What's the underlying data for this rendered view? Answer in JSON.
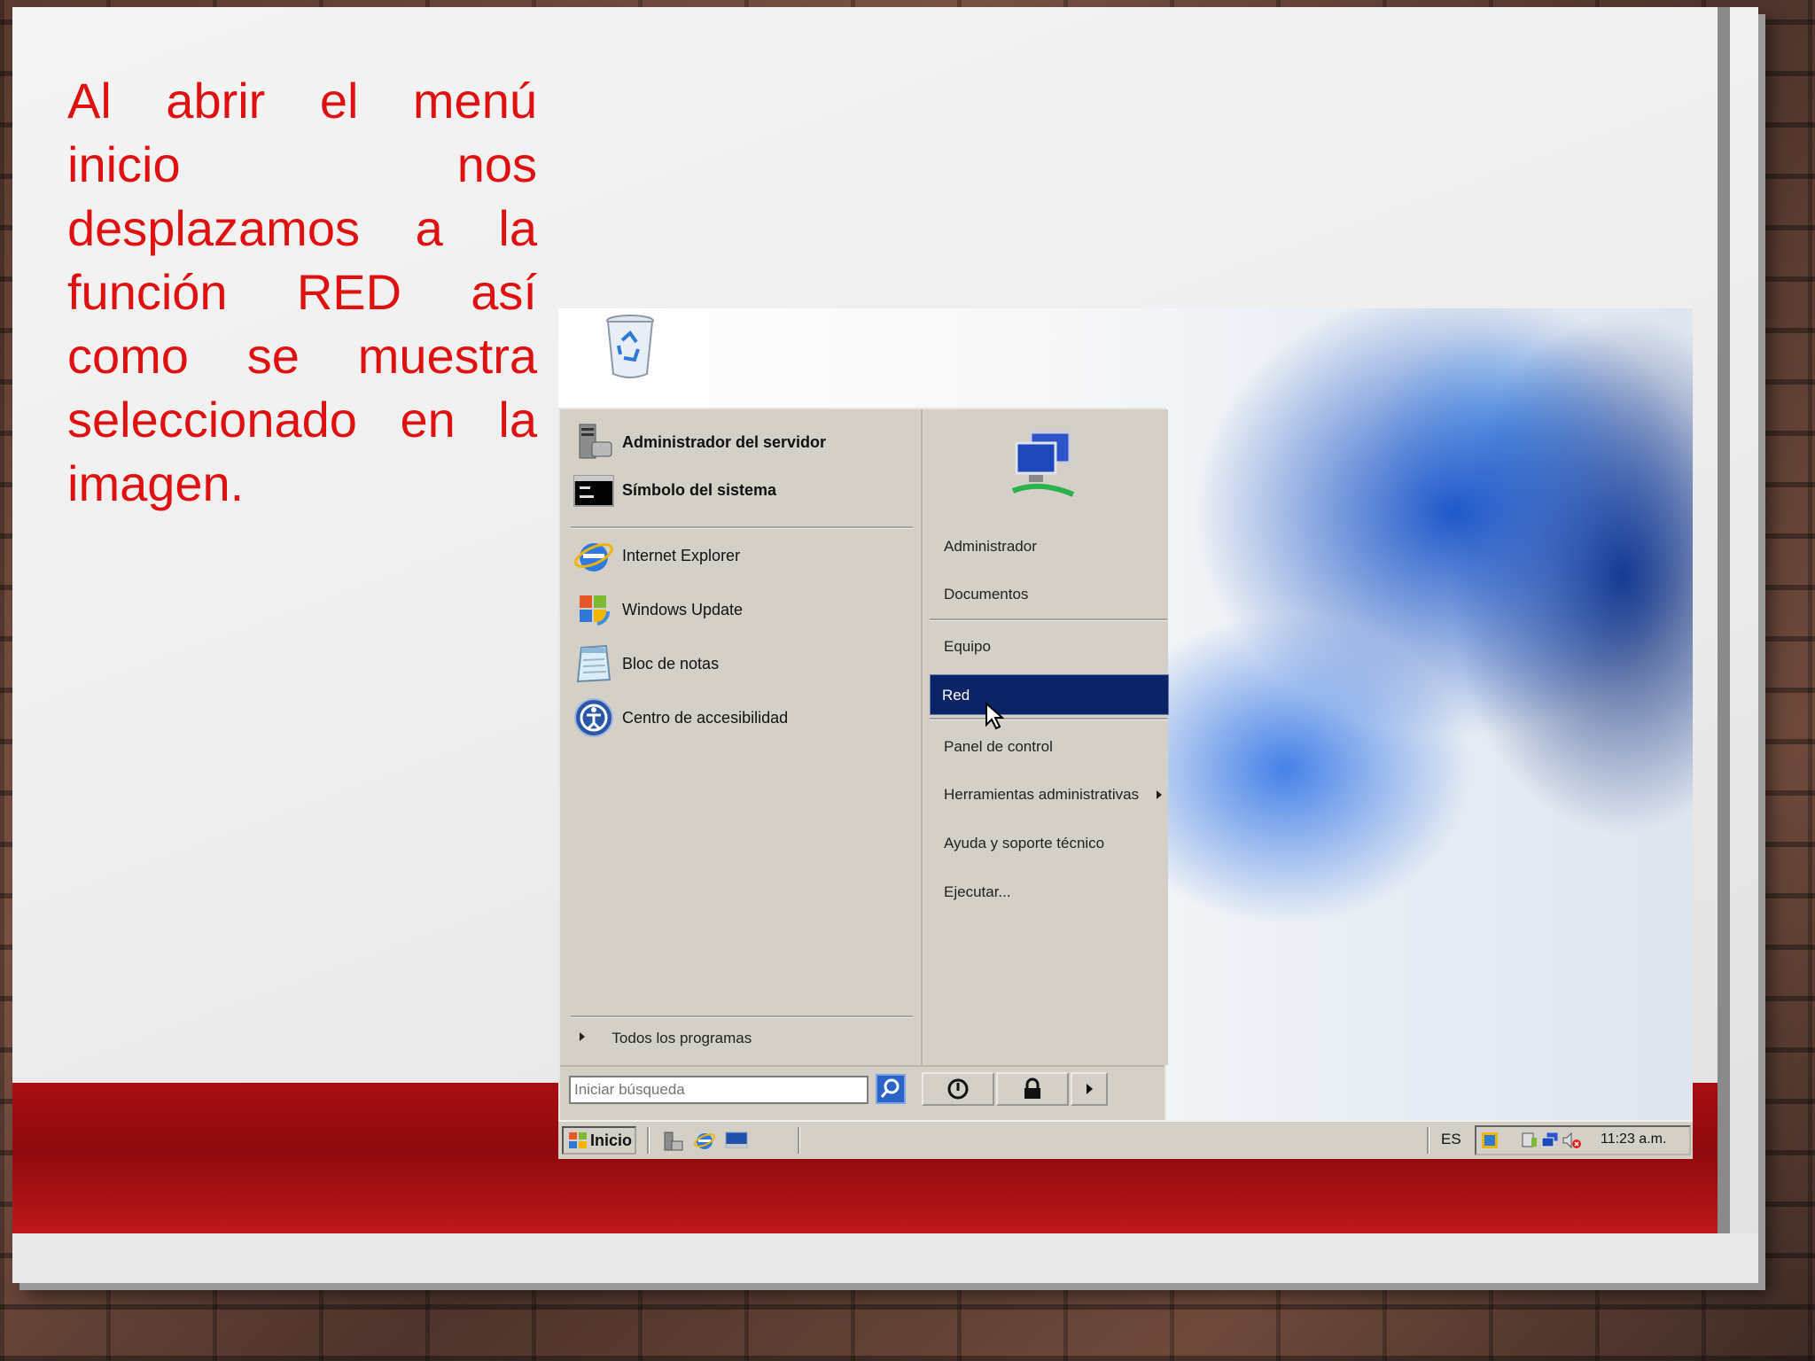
{
  "slide": {
    "text": "Al abrir el menú inicio nos desplazamos a la función RED así como se muestra seleccionado en la imagen.",
    "text_color": "#e01010",
    "accent_band": "#a80e12"
  },
  "start_menu": {
    "pinned": [
      {
        "label": "Administrador del servidor",
        "icon": "server-manager-icon"
      },
      {
        "label": "Símbolo del sistema",
        "icon": "command-prompt-icon"
      }
    ],
    "recent": [
      {
        "label": "Internet Explorer",
        "icon": "internet-explorer-icon"
      },
      {
        "label": "Windows Update",
        "icon": "windows-update-icon"
      },
      {
        "label": "Bloc de notas",
        "icon": "notepad-icon"
      },
      {
        "label": "Centro de accesibilidad",
        "icon": "accessibility-icon"
      }
    ],
    "all_programs": "Todos los programas",
    "search_placeholder": "Iniciar búsqueda",
    "right_items": [
      {
        "label": "Administrador"
      },
      {
        "label": "Documentos"
      },
      {
        "label": "Equipo"
      },
      {
        "label": "Red",
        "selected": true
      },
      {
        "label": "Panel de control"
      },
      {
        "label": "Herramientas administrativas",
        "submenu": true
      },
      {
        "label": "Ayuda y soporte técnico"
      },
      {
        "label": "Ejecutar..."
      }
    ],
    "selected_color": "#0b2466"
  },
  "taskbar": {
    "start_label": "Inicio",
    "language": "ES",
    "clock": "11:23 a.m."
  }
}
